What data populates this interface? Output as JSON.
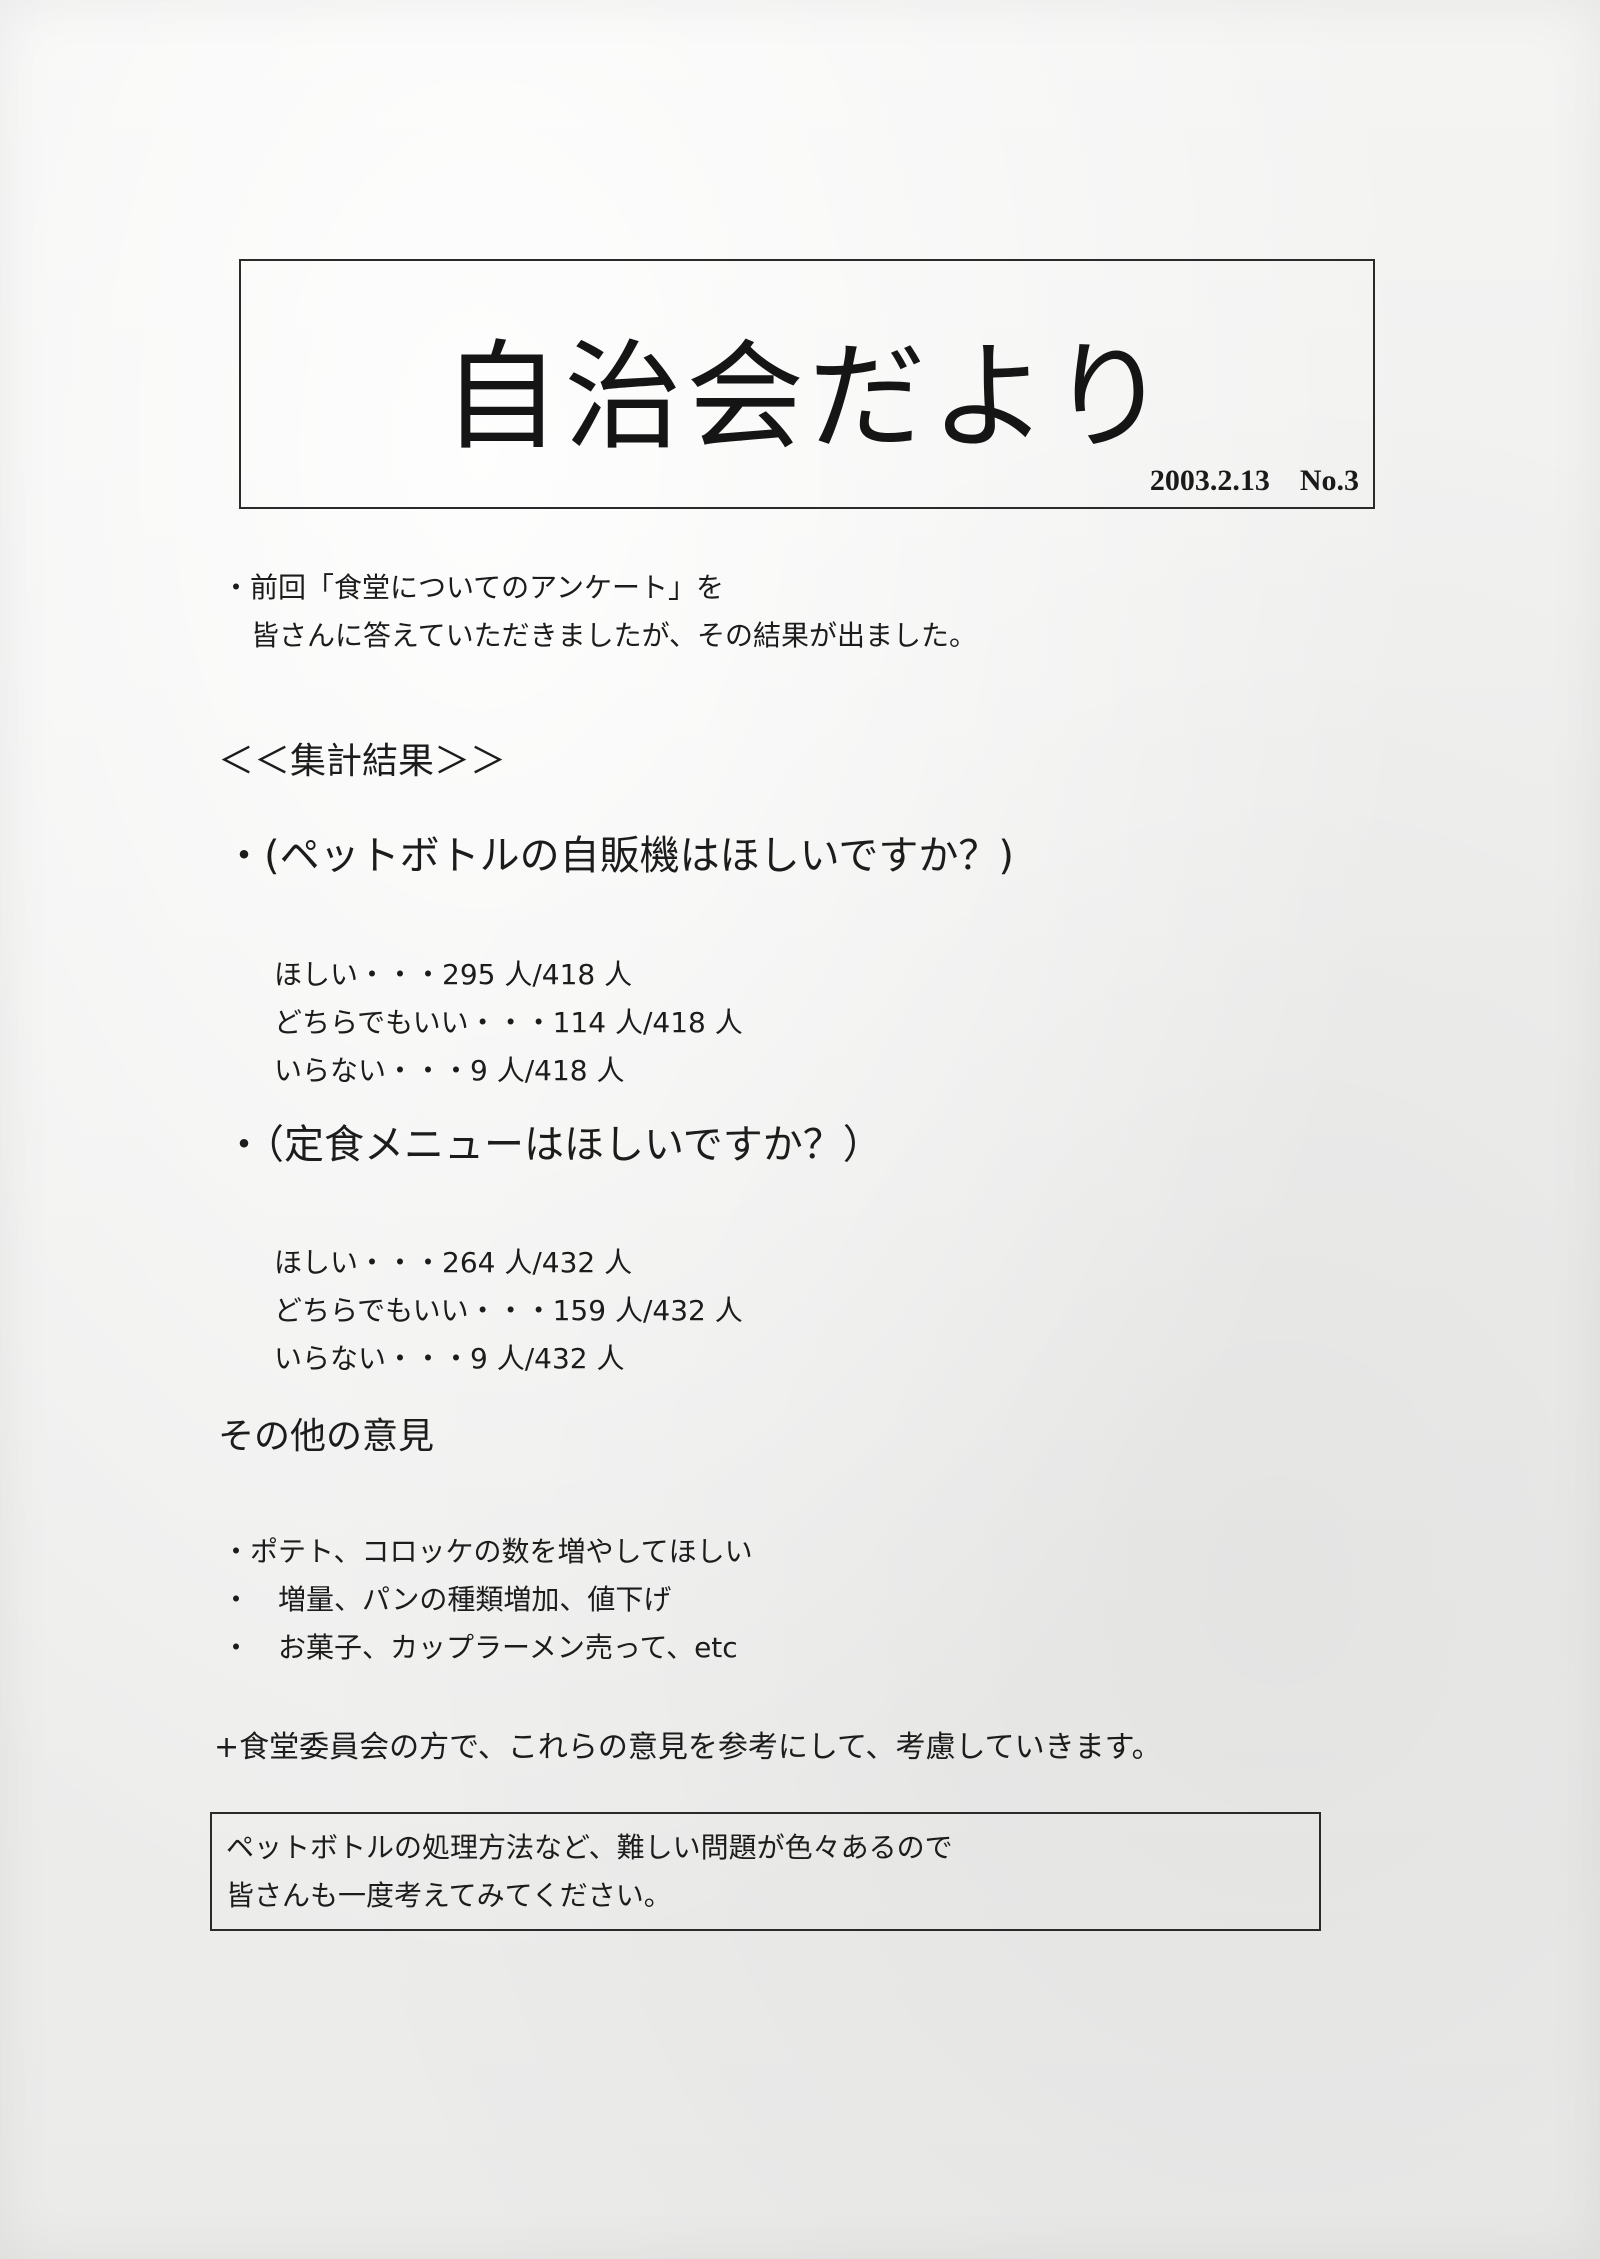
{
  "newsletter": {
    "title": "自治会だより",
    "issue": "2003.2.13　No.3"
  },
  "intro": {
    "line1": "・前回「食堂についてのアンケート」を",
    "line2": "皆さんに答えていただきましたが、その結果が出ました。"
  },
  "results_heading": "＜＜集計結果＞＞",
  "questions": [
    {
      "question": "・(ペットボトルの自販機はほしいですか？)",
      "answers": [
        "ほしい・・・295 人/418 人",
        "どちらでもいい・・・114 人/418 人",
        "いらない・・・9 人/418 人"
      ]
    },
    {
      "question": "・（定食メニューはほしいですか？）",
      "answers": [
        "ほしい・・・264 人/432 人",
        "どちらでもいい・・・159 人/432 人",
        "いらない・・・9 人/432 人"
      ]
    }
  ],
  "other_opinions": {
    "heading": "その他の意見",
    "items": [
      "・ポテト、コロッケの数を増やしてほしい",
      "・　増量、パンの種類増加、値下げ",
      "・　お菓子、カップラーメン売って、etc"
    ]
  },
  "committee_note": "+食堂委員会の方で、これらの意見を参考にして、考慮していきます。",
  "boxed_note": {
    "line1": "ペットボトルの処理方法など、難しい問題が色々あるので",
    "line2": "皆さんも一度考えてみてください。"
  }
}
